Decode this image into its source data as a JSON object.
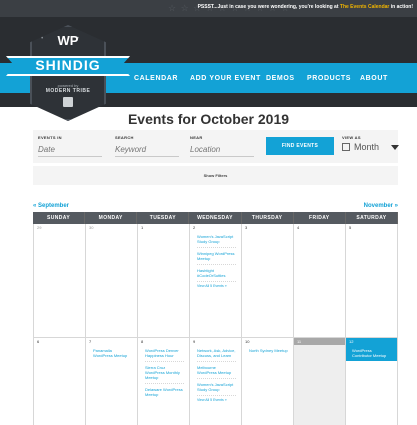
{
  "topbar": {
    "stars": "☆ ☆ ☆ ☆ ☆ ☆ ☆ ☆ ☆ ☆",
    "promo_text": "PSSST...Just in case you were wondering, you're looking at",
    "promo_highlight": "The Events Calendar",
    "promo_suffix": "in action!"
  },
  "logo": {
    "top": "WP",
    "name": "SHINDIG",
    "powered": "powered by",
    "brand": "MODERN TRIBE"
  },
  "nav": [
    "CALENDAR",
    "ADD YOUR EVENT",
    "DEMOS",
    "PRODUCTS",
    "ABOUT"
  ],
  "page_title": "Events for October 2019",
  "filters": {
    "events_in_label": "EVENTS IN",
    "events_in_placeholder": "Date",
    "search_label": "SEARCH",
    "search_placeholder": "Keyword",
    "near_label": "NEAR",
    "near_placeholder": "Location",
    "find_button": "FIND EVENTS",
    "view_as_label": "VIEW AS",
    "view_as_value": "Month",
    "show_filters": "Show Filters"
  },
  "nav_prev": "« September",
  "nav_next": "November »",
  "calendar": {
    "weekdays": [
      "SUNDAY",
      "MONDAY",
      "TUESDAY",
      "WEDNESDAY",
      "THURSDAY",
      "FRIDAY",
      "SATURDAY"
    ],
    "weeks": [
      {
        "days": [
          {
            "num": "29",
            "past": true,
            "events": []
          },
          {
            "num": "30",
            "past": true,
            "events": []
          },
          {
            "num": "1",
            "events": []
          },
          {
            "num": "2",
            "events": [
              "Women's JavaScript Study Group",
              "Winnipeg WordPress Meetup",
              "Hashtight #CodeOrSuttles"
            ],
            "view_all": "View All 5 Events »"
          },
          {
            "num": "3",
            "events": []
          },
          {
            "num": "4",
            "events": []
          },
          {
            "num": "5",
            "events": []
          }
        ]
      },
      {
        "days": [
          {
            "num": "6",
            "events": []
          },
          {
            "num": "7",
            "events": [
              "Panamalla WordPress Meetup"
            ]
          },
          {
            "num": "8",
            "events": [
              "WordPress Denver Happiness Hour",
              "Sierra Cruz WordPress Monthly Meetup",
              "Delaware WordPress Meetup"
            ]
          },
          {
            "num": "9",
            "events": [
              "Network, Ask, Advice, Discuss, and Learn",
              "Melbourne WordPress Meetup",
              "Women's JavaScript Study Group"
            ],
            "view_all": "View All 5 Events »"
          },
          {
            "num": "10",
            "events": [
              "North Sydney Meetup"
            ]
          },
          {
            "num": "11",
            "gray": true,
            "events": []
          },
          {
            "num": "12",
            "today": true,
            "events": [
              "WordPress Contributor Meetup"
            ]
          }
        ]
      }
    ]
  }
}
